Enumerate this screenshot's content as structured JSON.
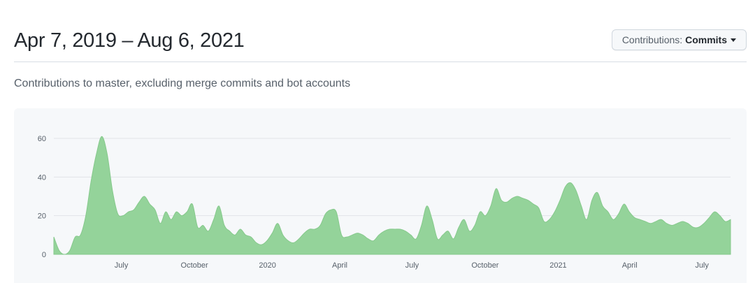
{
  "header": {
    "title": "Apr 7, 2019 – Aug 6, 2021",
    "contributions_label": "Contributions:",
    "contributions_value": "Commits"
  },
  "subtitle": "Contributions to master, excluding merge commits and bot accounts",
  "colors": {
    "area_fill": "#94d39a",
    "area_stroke": "#86c98c",
    "gridline": "#e1e4e8",
    "chart_bg": "#f6f8fa"
  },
  "chart_data": {
    "type": "area",
    "title": "",
    "xlabel": "",
    "ylabel": "",
    "ylim": [
      0,
      60
    ],
    "yticks": [
      0,
      20,
      40,
      60
    ],
    "grid": true,
    "xticks": [
      "July",
      "October",
      "2020",
      "April",
      "July",
      "October",
      "2021",
      "April",
      "July"
    ],
    "x_start": "2019-04-07",
    "x_end": "2021-08-06",
    "series": [
      {
        "values": [
          9,
          2,
          0,
          2,
          9,
          10,
          20,
          38,
          52,
          61,
          52,
          33,
          21,
          20,
          22,
          23,
          27,
          30,
          26,
          23,
          16,
          22,
          18,
          22,
          20,
          22,
          26,
          14,
          15,
          12,
          18,
          25,
          15,
          12,
          10,
          13,
          10,
          9,
          6,
          5,
          7,
          11,
          16,
          10,
          7,
          6,
          8,
          11,
          13,
          13,
          15,
          21,
          23,
          22,
          10,
          9,
          10,
          11,
          10,
          8,
          7,
          10,
          12,
          13,
          13,
          13,
          12,
          10,
          8,
          15,
          25,
          18,
          8,
          10,
          12,
          8,
          14,
          18,
          12,
          15,
          22,
          20,
          25,
          34,
          28,
          27,
          29,
          30,
          29,
          28,
          26,
          24,
          17,
          18,
          22,
          28,
          35,
          37,
          33,
          25,
          18,
          28,
          32,
          25,
          22,
          18,
          21,
          26,
          22,
          19,
          18,
          17,
          16,
          17,
          18,
          16,
          15,
          16,
          17,
          16,
          14,
          14,
          16,
          19,
          22,
          20,
          17,
          18
        ]
      }
    ]
  }
}
